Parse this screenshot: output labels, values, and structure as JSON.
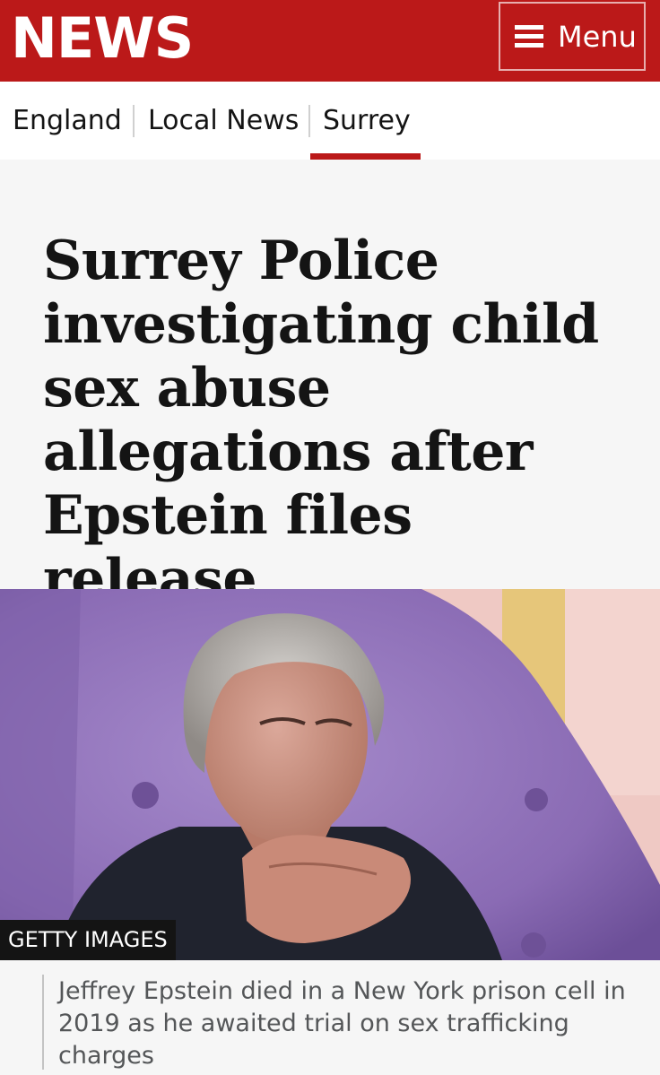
{
  "masthead": {
    "brand": "NEWS",
    "menu_label": "Menu",
    "menu_icon": "hamburger-menu-icon",
    "background_color": "#bb1919"
  },
  "subnav": {
    "items": [
      {
        "label": "England"
      },
      {
        "label": "Local News"
      },
      {
        "label": "Surrey"
      }
    ],
    "active_item": "Surrey",
    "accent_color": "#bb1919"
  },
  "article": {
    "headline": "Surrey Police investigating child sex abuse allegations after Epstein files release",
    "image": {
      "credit": "GETTY IMAGES",
      "caption": "Jeffrey Epstein died in a New York prison cell in 2019 as he awaited trial on sex trafficking charges"
    }
  }
}
